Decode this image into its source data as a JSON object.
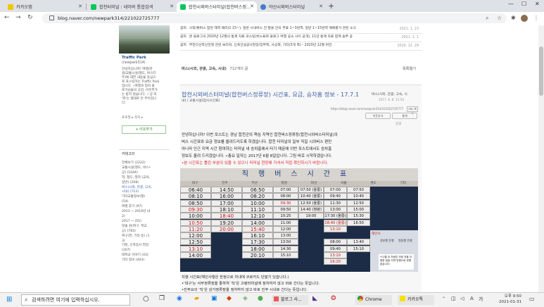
{
  "browser": {
    "tabs": [
      {
        "label": "카카오맵",
        "fav_color": "#f5c400"
      },
      {
        "label": "합천터미널 : 네이버 통합검색",
        "fav_color": "#03c75a"
      },
      {
        "label": "합천시외버스터미널(합천버스정...",
        "fav_color": "#03c75a"
      },
      {
        "label": "야산시외버스터미널",
        "fav_color": "#4b78ca"
      }
    ],
    "url": "blog.naver.com/newpark314/221022725777"
  },
  "sidebar": {
    "blog_name": "Traffic Park",
    "blog_id": "(newpark314)",
    "intro": [
      "안녕하십니까? 여행/관",
      "광/교통시설(철도, 버스터",
      "주)에 대한 내용을 중심으",
      "로 포스팅하는 Traffic Park",
      "입니다. ⋆여행과 업자 블",
      "로거님들의 공감, 이웃추가",
      "는 받지 않습니다. ⋆'공'과",
      "'와'는 절대로 안 주어집니",
      "다."
    ],
    "profile_link": "프로필 ▸ 쪽지 ▸",
    "neighbor_button": "+ 이웃추가",
    "category_label": "카테고리",
    "categories": [
      "전체보기 (2222)",
      "교통시설(철도, 버스•",
      "공) (1044)",
      "역, 철도, 열차 (교육,",
      "일반) (208)",
      "버스(시외, 관광, 고속,",
      "시내) (712)",
      "기타교통정보(철)",
      "(54)",
      "여행 후기 (97)",
      "2013 ~ 2016년 (4",
      "2)",
      "2017 ~ (55)",
      "맛올 원(여구, 학교",
      "공) (783)",
      "여구(한, 기타 등) (1",
      "3)",
      "가정, 신축증사 현장",
      "(167)",
      "대학교 이야기 (43)",
      "기타 정보 (403)"
    ]
  },
  "main": {
    "notices": [
      {
        "kind": "공지",
        "text": "시외/류버스 합천 해역 패러(2.15~), 일반 시내버스 전 말을 안의 무료 1~3번역, 일반 1~15번역 예매를가 관련 소식",
        "date": "2021. 1. 23"
      },
      {
        "kind": "공지",
        "text": "본 블로그의 2020년 12월의 통계 자료 포스팅(버스표와 블로그 여행 공소 사이 공개), 11년 통계 자료 합계 송부 공",
        "date": "2021. 1. 1"
      },
      {
        "kind": "공지",
        "text": "부천다산착신전철 관련 보리워, 신축건설공사현장/장부쪽, 사상쪽, 기타(3개 쪽) - 2020년 12월 버전",
        "date": "2020. 12. 29"
      }
    ],
    "category_line": "버스(시외, 관광, 고속, 시내)",
    "category_count": "712개의 글",
    "list_toggle": "목록열기",
    "post_title": "합천시외버스터미널(합천버스정류장) 시간표, 요금, 승차홈 정보 - 17.7.1",
    "post_category": "버스(시외, 관광, 고속, 시",
    "post_category2": "내) / 교통시설(업시시간표)",
    "post_date": "2017. 6. 8. 11:54",
    "post_url": "https://blog.naver.com/newpark314/221022725777",
    "copy_url": "URL 복사",
    "neighbor_add": "이웃추가",
    "stats": "통계",
    "report": "신고",
    "body": [
      "안녕하십니까? 이번 포스트는 경남 합천군의 핵심 지역인 합천버스정류장(합천시외버스터미널)의",
      "버스 시간표와 요금 정보를 올려드리도록 하겠습니다. 합천 터미널의 일부 직일 시외버스 편만",
      "아니라 인근 지역 시간 참여하는 터미널 내 승차홈에서 타기 때문에 이번 포스트에서도 승차홈",
      "정보도 올려 드리겠습니다. •총요 일자는 2017년 6월 8일입니다. 그림 바로 시작하겠습니다.",
      "•본 시간표는 틀린 부분이 있을 수 있으니 터미널 현장에 가셔서 직접 확인하시기 바랍니다."
    ],
    "board_title": "직행버스시간표",
    "board_cols": [
      "대구",
      "진주",
      "부산",
      "창원",
      "마산",
      "서울",
      "경도",
      "기타"
    ],
    "board_times": [
      [
        "06:40",
        "14:50",
        "06:50",
        "07:00",
        "07:50 (울릉)",
        "07:00",
        "07:50"
      ],
      [
        "08:10",
        "16:00",
        "08:20",
        "08:00",
        "10:40 (울릉)",
        "09:40",
        "10:40"
      ],
      [
        "08:50",
        "17:00",
        "10:00",
        "09:30",
        "12:50 (울릉)",
        "11:30",
        "12:50"
      ],
      [
        "09:30",
        "18:10",
        "11:10",
        "09:50",
        "14:40 (청량)",
        "13:00",
        "15:00"
      ],
      [
        "10:00",
        "18:40",
        "12:10",
        "10:25",
        "19:00",
        "17:30 (울릉)",
        "15:30"
      ],
      [
        "10:50",
        "19:20",
        "14:00",
        "11:00",
        "",
        "18:40 (울릉)",
        "16:50"
      ],
      [
        "11:20",
        "20:00",
        "15:40",
        "12:00",
        "",
        "13:10",
        ""
      ],
      [
        "12:00",
        "",
        "16:10",
        "13:00",
        "",
        "",
        ""
      ],
      [
        "12:50",
        "",
        "17:30",
        "13:50",
        "",
        "08:00",
        "13:40"
      ],
      [
        "13:10",
        "",
        "18:00",
        "14:30",
        "",
        "09:40",
        "15:10"
      ],
      [
        "14:00",
        "",
        "20:10",
        "15:10",
        "",
        "13:10",
        ""
      ],
      [
        "",
        "",
        "",
        "",
        "",
        "16:20",
        ""
      ]
    ],
    "board_note": "*12월 요 차량은 의정 전을 이용한 일일 지역 방향으로 운행 없습니다.",
    "board_side_labels": [
      "해인사",
      "경부행 운행",
      "명동행 운행"
    ],
    "caption": [
      "직행 시간표(해인사행은 한정으로 차내에 코로카드 단말기 있습니다.)",
      "•'대구'는 서부정류장을 통하여 '직'은 고령터미널에 정차하지 않고 바로 간다는 뜻입니다.",
      "•진주요의 '직'은 삼가정류장을 정차하지 않고 바로 진주 시내로 간다는 뜻입니다."
    ]
  },
  "taskbar": {
    "search_placeholder": "검색하려면 여기에 입력하십시오.",
    "apps": [
      "블로그 사...",
      "Chrome",
      "카카오톡"
    ],
    "time": "오후 9:50",
    "date": "2021-01-31"
  },
  "colors": {
    "link_blue": "#3b62a8",
    "warn_red": "#e0202a",
    "board_navy": "#1d2c46",
    "naver_green": "#03c75a"
  }
}
